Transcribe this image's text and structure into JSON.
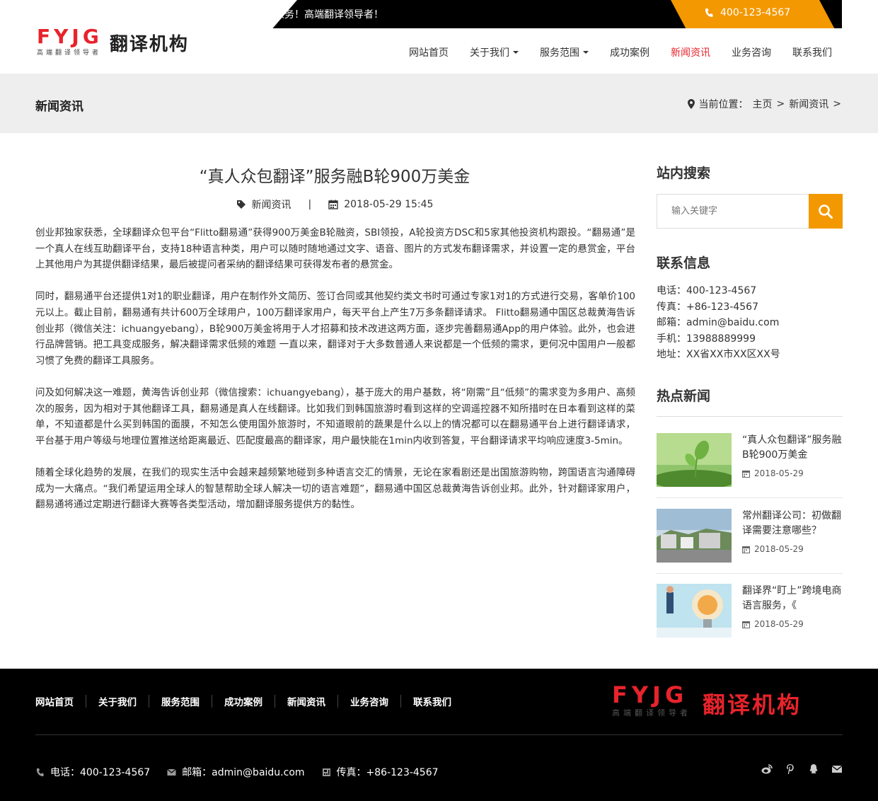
{
  "header": {
    "slogan": "于翻译服务！高端翻译领导者！",
    "phone": "400-123-4567",
    "logo": {
      "brand": "FYJG",
      "tagline": "高端翻译领导者",
      "name": "翻译机构"
    },
    "nav": [
      {
        "label": "网站首页"
      },
      {
        "label": "关于我们"
      },
      {
        "label": "服务范围"
      },
      {
        "label": "成功案例"
      },
      {
        "label": "新闻资讯"
      },
      {
        "label": "业务咨询"
      },
      {
        "label": "联系我们"
      }
    ]
  },
  "banner": {
    "title": "新闻资讯",
    "crumb_prefix": "当前位置：",
    "crumb_home": "主页",
    "crumb_sep1": ">",
    "crumb_section": "新闻资讯",
    "crumb_sep2": ">"
  },
  "article": {
    "title": "“真人众包翻译”服务融B轮900万美金",
    "category": "新闻资讯",
    "separator": "|",
    "datetime": "2018-05-29 15:45",
    "paragraphs": [
      "创业邦独家获悉，全球翻译众包平台“Flitto翻易通”获得900万美金B轮融资，SBI领投，A轮投资方DSC和5家其他投资机构跟投。“翻易通”是一个真人在线互助翻译平台，支持18种语言种类，用户可以随时随地通过文字、语音、图片的方式发布翻译需求，并设置一定的悬赏金，平台上其他用户为其提供翻译结果，最后被提问者采纳的翻译结果可获得发布者的悬赏金。",
      "同时，翻易通平台还提供1对1的职业翻译，用户在制作外文简历、签订合同或其他契约类文书时可通过专家1对1的方式进行交易，客单价100元以上。截止目前，翻易通有共计600万全球用户，100万翻译家用户，每天平台上产生7万多条翻译请求。 Flitto翻易通中国区总裁黄海告诉创业邦（微信关注：ichuangyebang），B轮900万美金将用于人才招募和技术改进这两方面，逐步完善翻易通App的用户体验。此外，也会进行品牌营销。把工具变成服务，解决翻译需求低频的难题 一直以来，翻译对于大多数普通人来说都是一个低频的需求，更何况中国用户一般都习惯了免费的翻译工具服务。",
      "问及如何解决这一难题，黄海告诉创业邦（微信搜索：ichuangyebang），基于庞大的用户基数，将“刚需”且“低频”的需求变为多用户、高频次的服务，因为相对于其他翻译工具，翻易通是真人在线翻译。比如我们到韩国旅游时看到这样的空调遥控器不知所措时在日本看到这样的菜单，不知道都是什么买到韩国的面膜，不知怎么使用国外旅游时，不知道眼前的蔬果是什么以上的情况都可以在翻易通平台上进行翻译请求，平台基于用户等级与地理位置推送给距离最近、匹配度最高的翻译家，用户最快能在1min内收到答复，平台翻译请求平均响应速度3-5min。",
      "随着全球化趋势的发展，在我们的现实生活中会越来越频繁地碰到多种语言交汇的情景，无论在家看剧还是出国旅游购物，跨国语言沟通障碍成为一大痛点。“我们希望运用全球人的智慧帮助全球人解决一切的语言难题”，翻易通中国区总裁黄海告诉创业邦。此外，针对翻译家用户，翻易通将通过定期进行翻译大赛等各类型活动，增加翻译服务提供方的黏性。"
    ]
  },
  "sidebar": {
    "search_title": "站内搜索",
    "search_placeholder": "输入关键字",
    "contact_title": "联系信息",
    "contact": [
      "电话：400-123-4567",
      "传真：+86-123-4567",
      "邮箱：admin@baidu.com",
      "手机：13988889999",
      "地址：XX省XX市XX区XX号"
    ],
    "hot_title": "热点新闻",
    "hot": [
      {
        "title": "“真人众包翻译”服务融B轮900万美金",
        "date": "2018-05-29"
      },
      {
        "title": "常州翻译公司：初做翻译需要注意哪些？",
        "date": "2018-05-29"
      },
      {
        "title": "翻译界“盯上”跨境电商语言服务，《",
        "date": "2018-05-29"
      }
    ]
  },
  "footer": {
    "nav": [
      "网站首页",
      "关于我们",
      "服务范围",
      "成功案例",
      "新闻资讯",
      "业务咨询",
      "联系我们"
    ],
    "logo": {
      "brand": "FYJG",
      "tagline": "高端翻译领导者",
      "name": "翻译机构"
    },
    "phone": "电话：400-123-4567",
    "email": "邮箱：admin@baidu.com",
    "fax": "传真：+86-123-4567"
  },
  "colors": {
    "accent": "#f39800",
    "brand_red": "#e8232b",
    "footer_bg": "#000000",
    "banner_bg": "#eeeeee"
  }
}
